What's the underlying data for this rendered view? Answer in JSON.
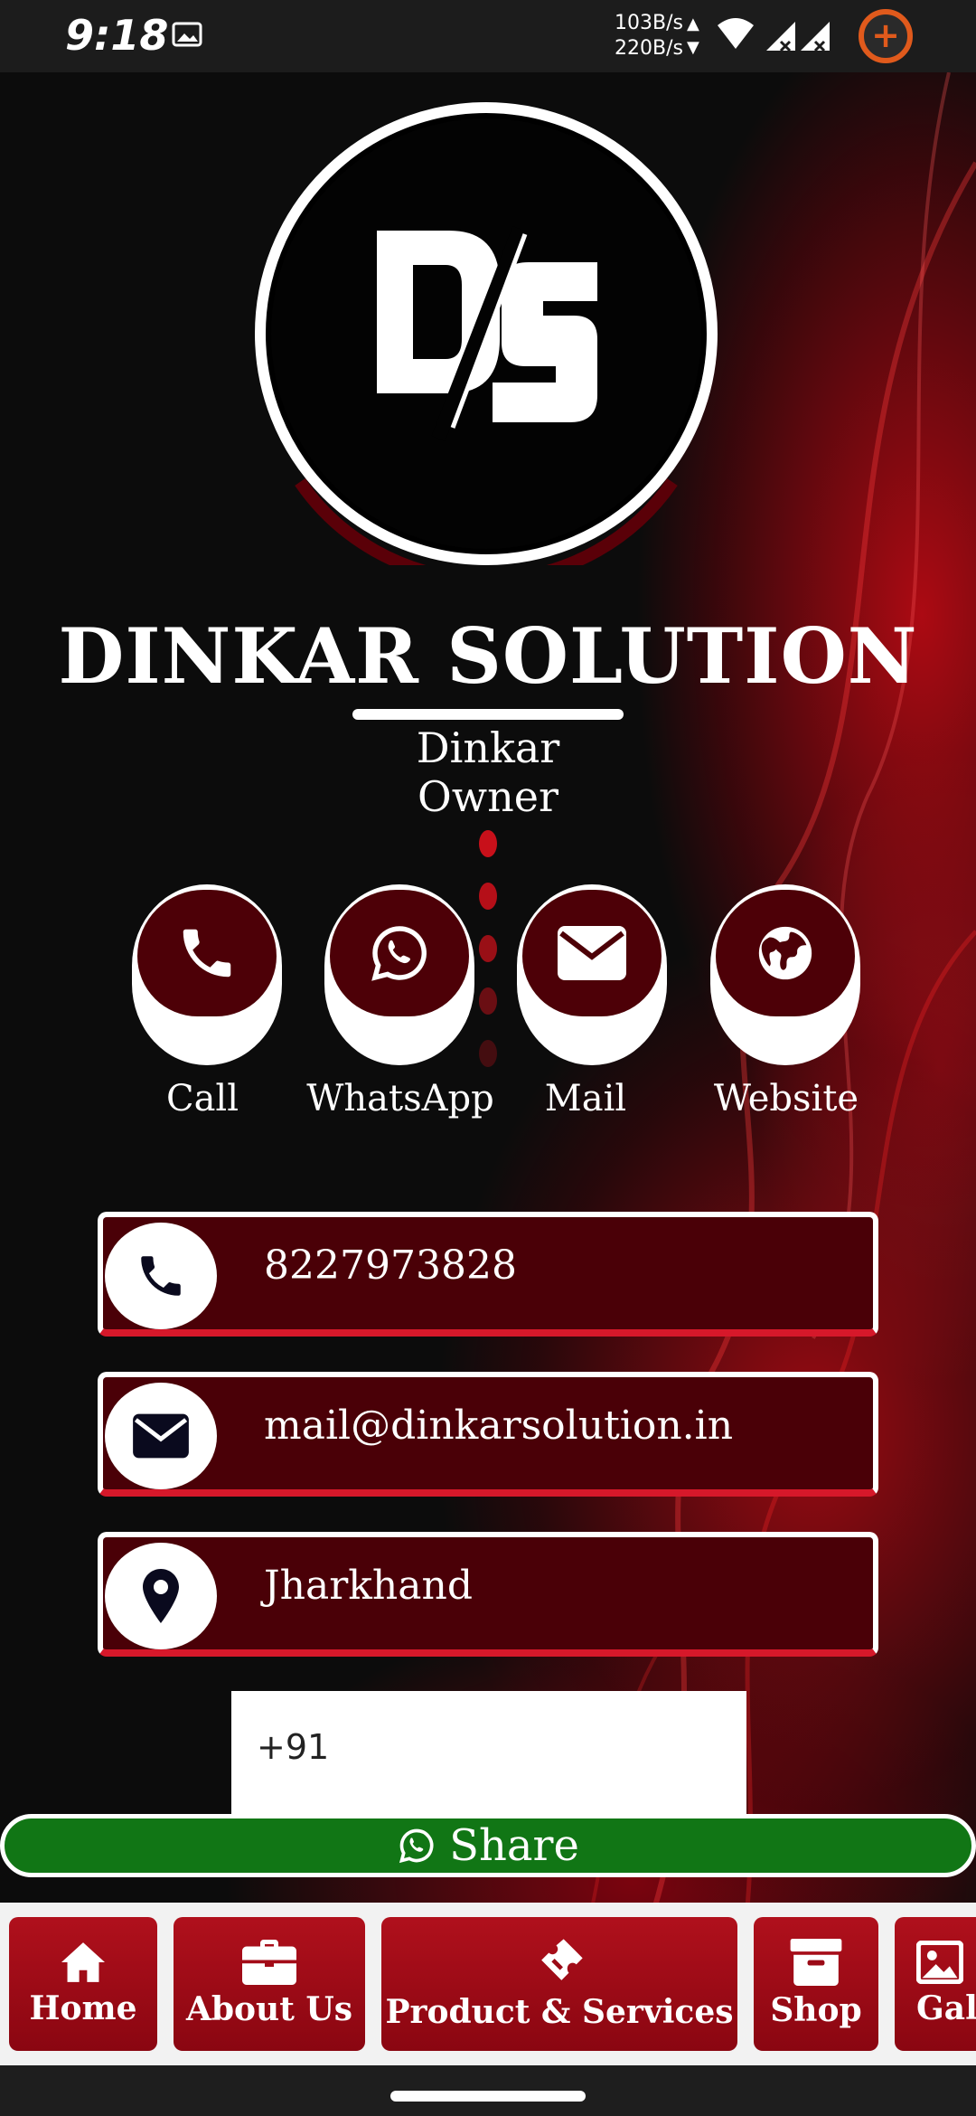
{
  "status_bar": {
    "time": "9:18",
    "net_up": "103B/s",
    "net_down": "220B/s",
    "icons": [
      "image-icon",
      "wifi-icon",
      "signal-icon",
      "signal-icon",
      "battery-saver-icon"
    ]
  },
  "profile": {
    "logo_text": "DS",
    "company_name": "DINKAR SOLUTION",
    "person_name": "Dinkar",
    "person_role": "Owner"
  },
  "actions": [
    {
      "label": "Call",
      "icon": "phone-icon"
    },
    {
      "label": "WhatsApp",
      "icon": "whatsapp-icon"
    },
    {
      "label": "Mail",
      "icon": "mail-icon"
    },
    {
      "label": "Website",
      "icon": "globe-icon"
    }
  ],
  "contact": {
    "phone": "8227973828",
    "email": "mail@dinkarsolution.in",
    "location": "Jharkhand"
  },
  "share": {
    "phone_prefix": "+91",
    "button_label": "Share"
  },
  "nav": [
    {
      "label": "Home",
      "icon": "home-icon"
    },
    {
      "label": "About Us",
      "icon": "briefcase-icon"
    },
    {
      "label": "Product & Services",
      "icon": "ticket-icon"
    },
    {
      "label": "Shop",
      "icon": "shop-icon"
    },
    {
      "label": "Gall",
      "icon": "gallery-icon"
    }
  ],
  "colors": {
    "primary": "#4a0007",
    "accent": "#d6182a",
    "share_green": "#117615"
  }
}
